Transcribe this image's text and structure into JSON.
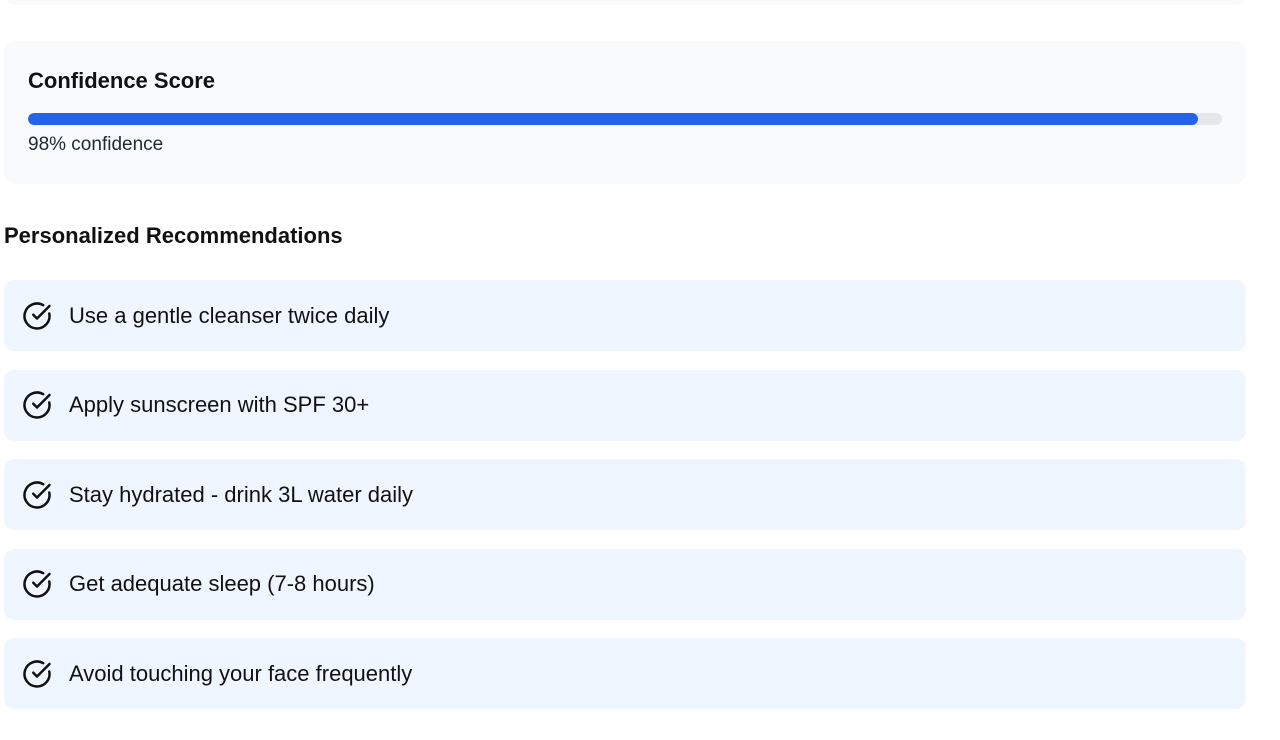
{
  "confidence": {
    "title": "Confidence Score",
    "value": 0.98,
    "label": "98% confidence",
    "bar_color": "#2563eb",
    "track_color": "#e5e7eb"
  },
  "recommendations": {
    "title": "Personalized Recommendations",
    "icon": "check-circle-icon",
    "items": [
      {
        "text": "Use a gentle cleanser twice daily"
      },
      {
        "text": "Apply sunscreen with SPF 30+"
      },
      {
        "text": "Stay hydrated - drink 3L water daily"
      },
      {
        "text": "Get adequate sleep (7-8 hours)"
      },
      {
        "text": "Avoid touching your face frequently"
      }
    ]
  }
}
